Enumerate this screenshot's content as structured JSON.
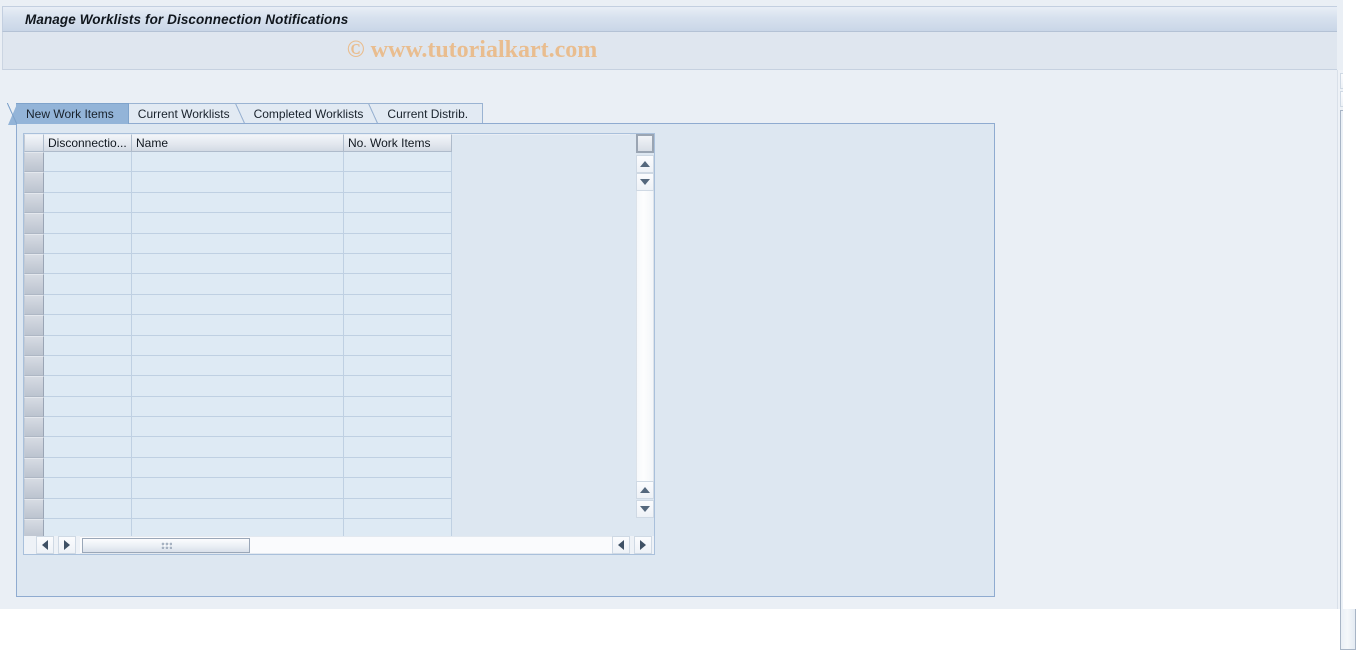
{
  "window": {
    "title": "Manage Worklists for Disconnection Notifications",
    "watermark": "© www.tutorialkart.com"
  },
  "tabs": [
    {
      "label": "New Work Items",
      "active": true,
      "name": "tab-new-work-items"
    },
    {
      "label": "Current Worklists",
      "active": false,
      "name": "tab-current-worklists"
    },
    {
      "label": "Completed Worklists",
      "active": false,
      "name": "tab-completed-worklists"
    },
    {
      "label": "Current Distrib.",
      "active": false,
      "name": "tab-current-distrib"
    }
  ],
  "grid": {
    "columns": [
      {
        "label": "Disconnectio...",
        "class": "col-disc",
        "name": "column-header-disconnection"
      },
      {
        "label": "Name",
        "class": "col-name",
        "name": "column-header-name"
      },
      {
        "label": "No. Work Items",
        "class": "col-items",
        "name": "column-header-no-work-items"
      }
    ],
    "row_count": 19,
    "rows": [],
    "empty": true
  },
  "scrollbars": {
    "grid_vertical": {
      "up": "▲",
      "down": "▼"
    },
    "grid_horizontal": {
      "left": "◀",
      "right": "▶"
    },
    "window_vertical": {
      "up": "▲",
      "down": "▼"
    }
  },
  "colors": {
    "title_bar": "#d7e1ee",
    "active_tab": "#93b4d8",
    "inactive_tab": "#e2eaf3",
    "panel_bg": "#dde7f1",
    "cell_bg": "#deeaf4",
    "watermark": "#e9bd8f",
    "panel_border": "#8fabd0"
  }
}
